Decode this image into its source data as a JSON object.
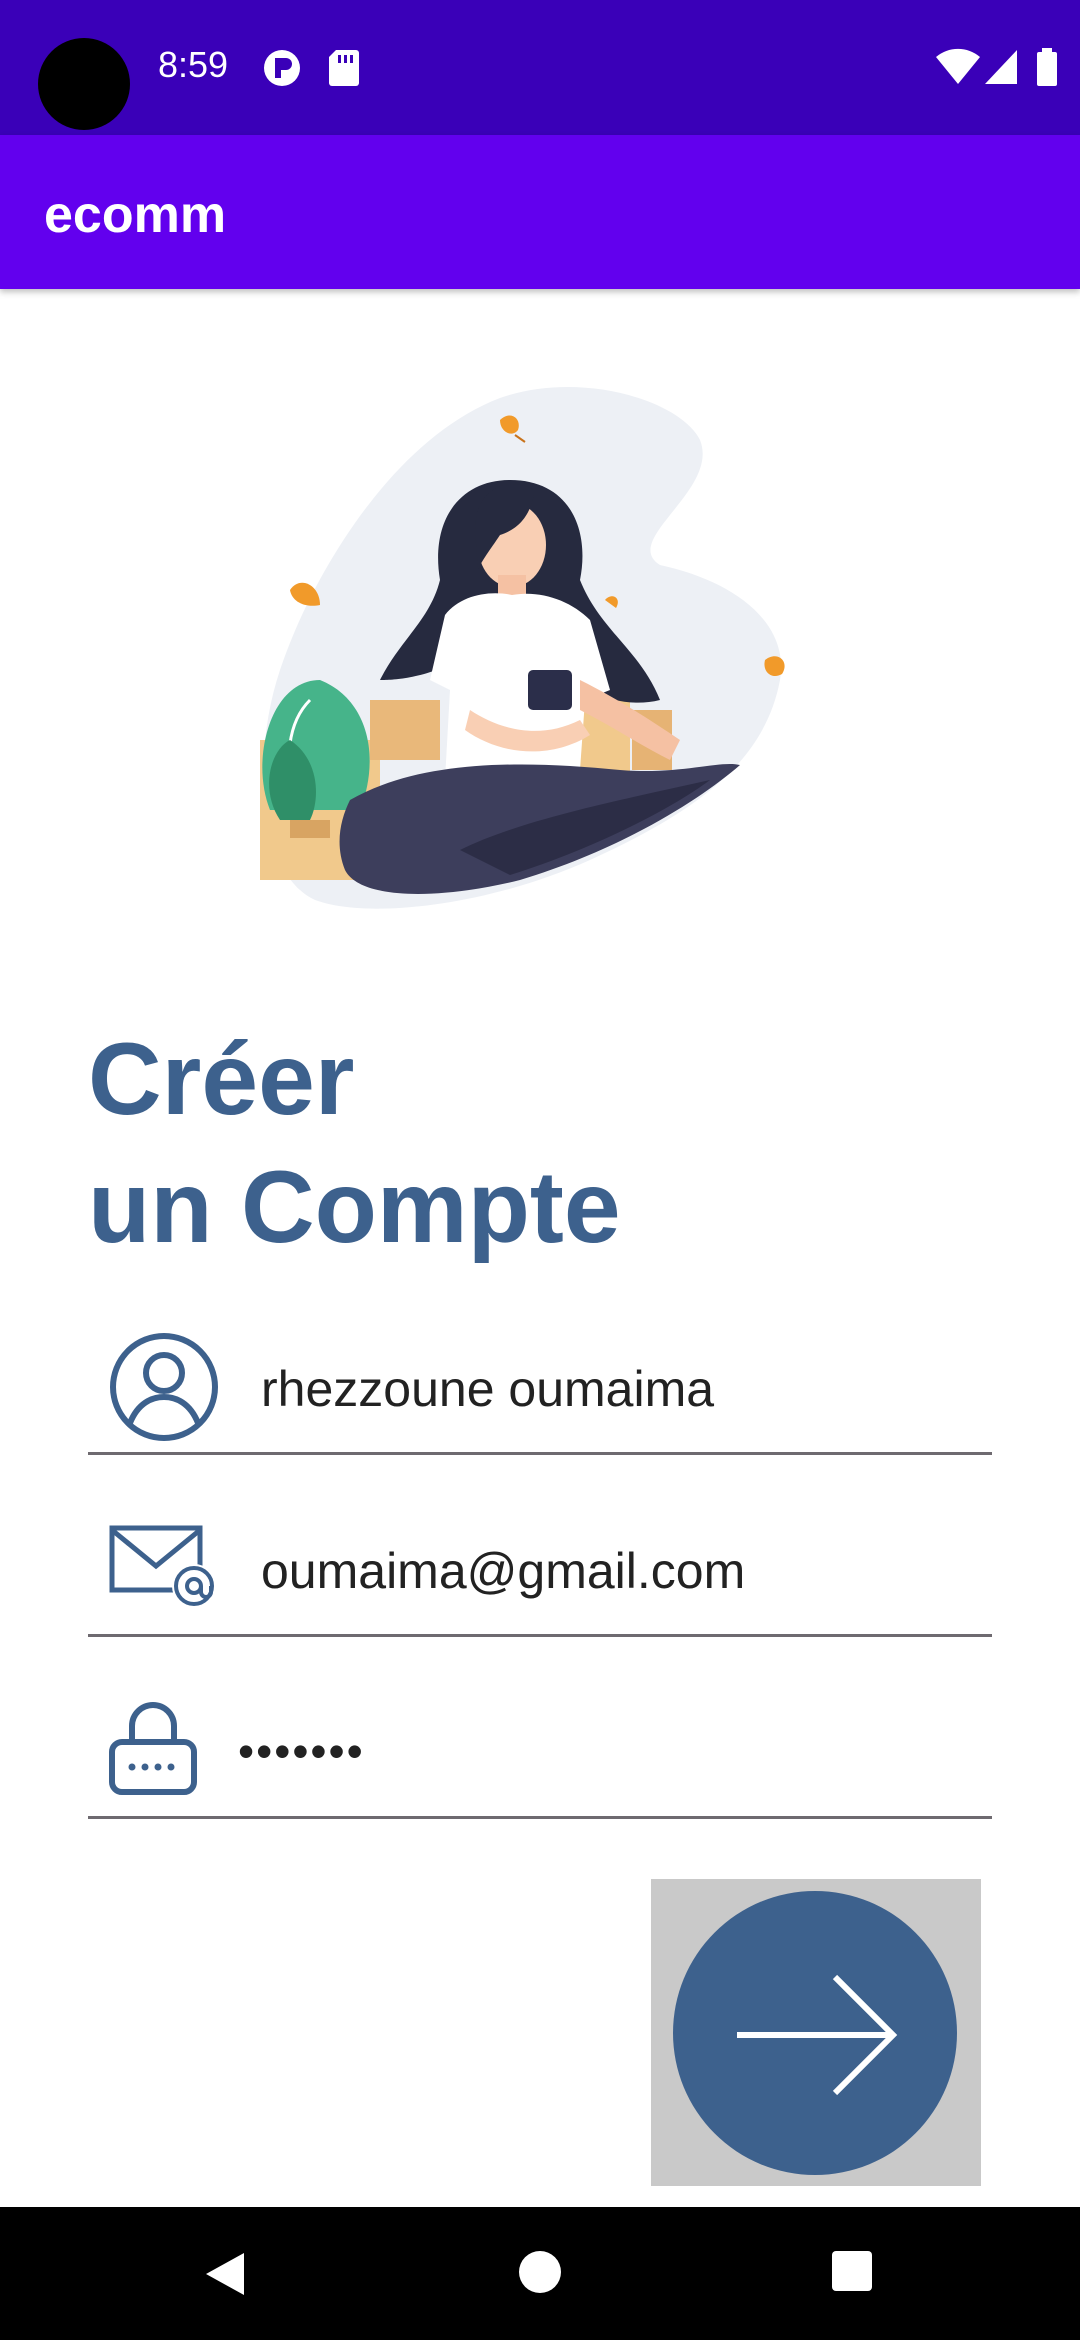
{
  "status_bar": {
    "time": "8:59",
    "left_icons": [
      "p-badge-icon",
      "sd-card-icon"
    ],
    "right_icons": [
      "wifi-icon",
      "signal-icon",
      "battery-icon"
    ]
  },
  "app_bar": {
    "title": "ecomm"
  },
  "heading": {
    "line1": "Créer",
    "line2": "un Compte"
  },
  "form": {
    "name": {
      "icon": "user-icon",
      "value": "rhezzoune oumaima"
    },
    "email": {
      "icon": "email-icon",
      "value": "oumaima@gmail.com"
    },
    "password": {
      "icon": "lock-icon",
      "value": "•••••••"
    }
  },
  "next_button": {
    "icon": "arrow-right-icon"
  },
  "nav_bar": {
    "buttons": [
      "back-icon",
      "home-icon",
      "recents-icon"
    ]
  },
  "colors": {
    "status_bar": "#3a00b8",
    "app_bar": "#6200ee",
    "accent": "#3d618d",
    "underline": "#6e6a70",
    "button_background": "#c9c9c9"
  }
}
